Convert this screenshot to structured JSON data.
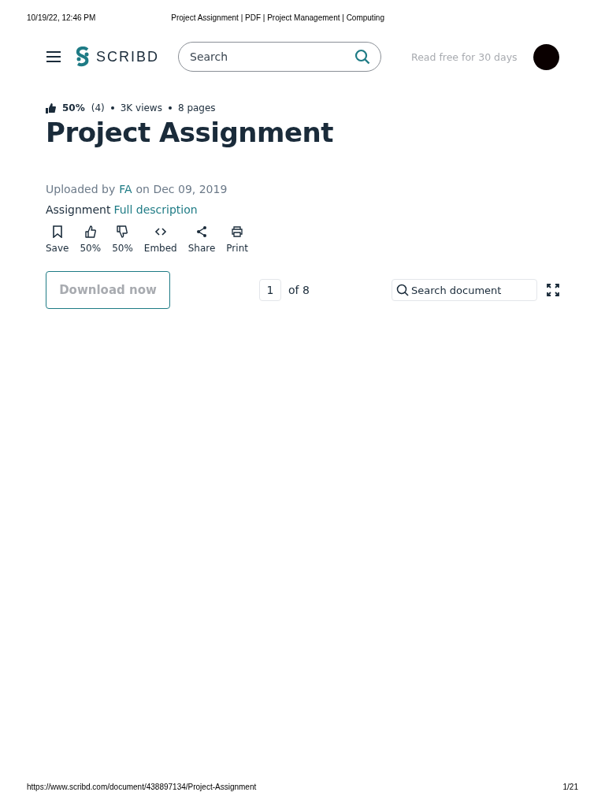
{
  "print_header": {
    "date": "10/19/22, 12:46 PM",
    "title": "Project Assignment | PDF | Project Management | Computing"
  },
  "navbar": {
    "logo": "SCRIBD",
    "search": {
      "placeholder": "Search"
    },
    "promo": "Read free for 30 days"
  },
  "meta": {
    "rating": "50%",
    "rating_count": "(4)",
    "views": "3K views",
    "pages": "8 pages"
  },
  "title": "Project Assignment",
  "uploaded": {
    "prefix": "Uploaded by",
    "uploader": "FA",
    "suffix": "on Dec 09, 2019"
  },
  "description": {
    "text": "Assignment",
    "link": "Full description"
  },
  "actions": [
    {
      "kind": "save",
      "label": "Save"
    },
    {
      "kind": "like",
      "label": "50%"
    },
    {
      "kind": "dislike",
      "label": "50%"
    },
    {
      "kind": "embed",
      "label": "Embed"
    },
    {
      "kind": "share",
      "label": "Share"
    },
    {
      "kind": "print",
      "label": "Print"
    }
  ],
  "toolbar": {
    "download": "Download now",
    "page": "1",
    "page_total": "of 8",
    "search": {
      "placeholder": "Search document"
    }
  },
  "print_footer": {
    "url": "https://www.scribd.com/document/438897134/Project-Assignment",
    "page": "1/21"
  }
}
